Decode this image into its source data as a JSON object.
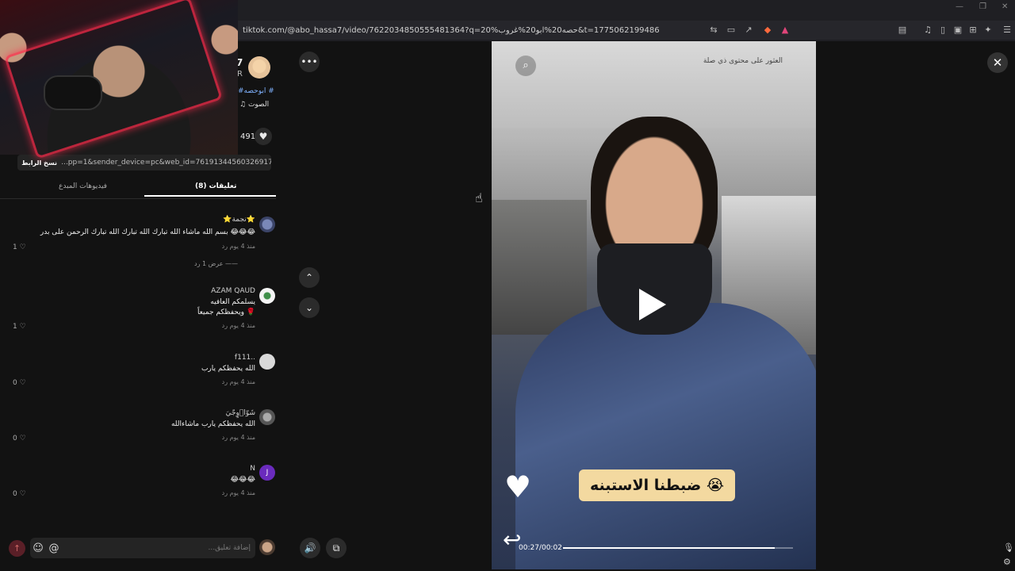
{
  "browser": {
    "url": "tiktok.com/@abo_hassa7/video/7622034850555481364?q=20%حصه20%ابو20%غروب&t=1775062199486"
  },
  "author": {
    "name": "7",
    "sub": "R",
    "hashtag": "#ابوحصه #",
    "sound": "♫ الصوت",
    "likes": "491"
  },
  "share": {
    "copy_label": "نسخ الرابط",
    "link": "...pp=1&sender_device=pc&web_id=7619134456032691720"
  },
  "tabs": {
    "comments": "تعليقات (8)",
    "creator_videos": "فيديوهات المبدع"
  },
  "comments": [
    {
      "name": "⭐نجمة⭐",
      "text": "بسم الله ماشاء الله تبارك الله تبارك الله تبارك الرحمن على بدر 😂😂😂",
      "meta": "منذ 4 يوم   رد",
      "likes": "1 ♡"
    },
    {
      "name": "AZAM QAUD",
      "text": "يسلمكم العافيه",
      "text2": "ويحفظكم جميعاً 🌹",
      "meta": "منذ 4 يوم   رد",
      "likes": "1 ♡"
    },
    {
      "name": "f111..",
      "text": "الله يحفظكم يارب",
      "meta": "منذ 4 يوم   رد",
      "likes": "0 ♡"
    },
    {
      "name": "شَوّاۤوٍجّيَ",
      "text": "الله يحفظكم يارب ماشاءالله",
      "meta": "منذ 4 يوم   رد",
      "likes": "0 ♡"
    },
    {
      "name": "N",
      "text": "😂😂😂",
      "meta": "منذ 4 يوم   رد",
      "likes": "0 ♡"
    }
  ],
  "view_replies": "عرض 1 رد ——",
  "avatar_letter": "J",
  "input": {
    "placeholder": "إضافة تعليق..."
  },
  "video": {
    "search_hint": "العثور على محتوى ذي صلة",
    "caption": "ضبطنا الاستبنه 😭",
    "time": "00:27/00:02",
    "progress": 0.92
  }
}
